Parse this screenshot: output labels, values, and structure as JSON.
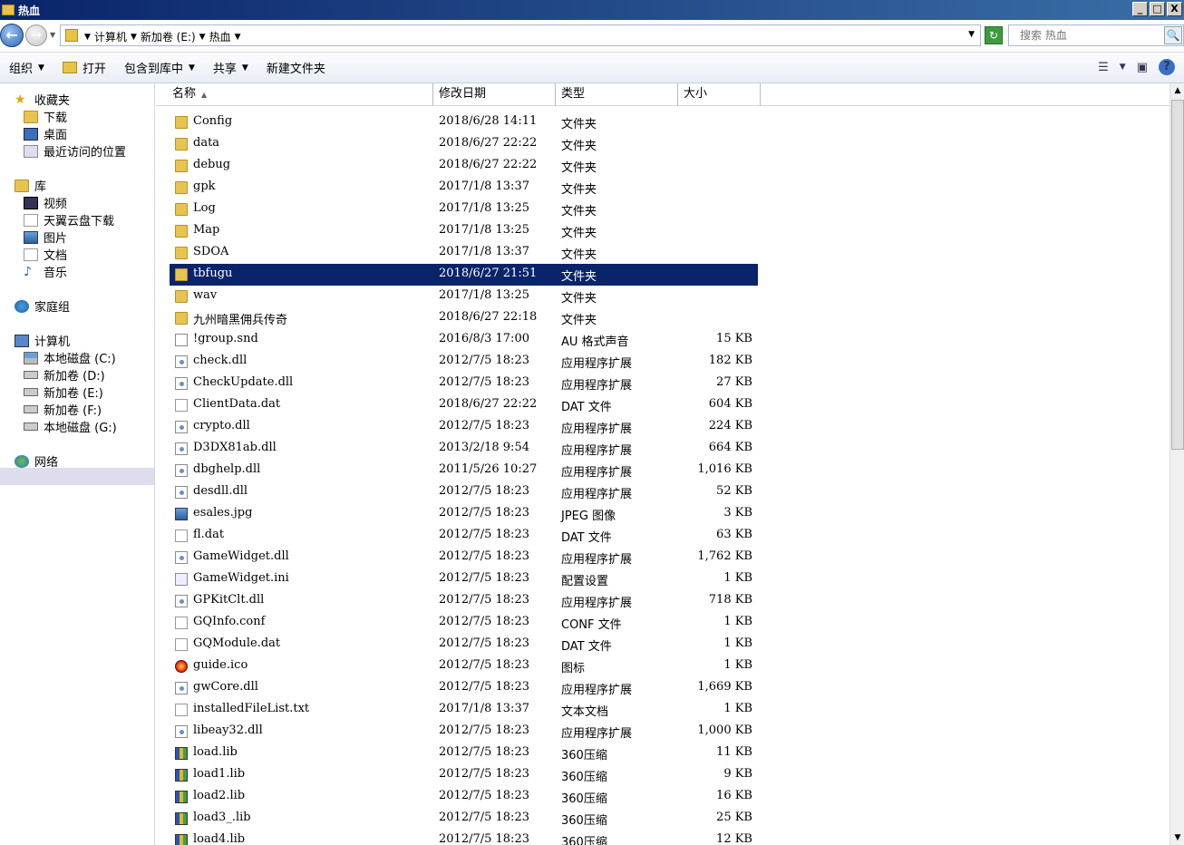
{
  "window": {
    "title": "热血",
    "min": "_",
    "max": "□",
    "close": "X"
  },
  "address": {
    "crumbs": [
      "计算机",
      "新加卷 (E:)",
      "热血"
    ]
  },
  "search": {
    "placeholder": "搜索 热血"
  },
  "toolbar": {
    "organize": "组织",
    "open": "打开",
    "include": "包含到库中",
    "share": "共享",
    "new_folder": "新建文件夹"
  },
  "nav": {
    "favorites": "收藏夹",
    "downloads": "下载",
    "desktop": "桌面",
    "recent": "最近访问的位置",
    "libraries": "库",
    "videos": "视频",
    "tianyi": "天翼云盘下载",
    "pictures": "图片",
    "documents": "文档",
    "music": "音乐",
    "homegroup": "家庭组",
    "computer": "计算机",
    "c": "本地磁盘 (C:)",
    "d": "新加卷 (D:)",
    "e": "新加卷 (E:)",
    "f": "新加卷 (F:)",
    "g": "本地磁盘 (G:)",
    "network": "网络"
  },
  "columns": {
    "name": "名称",
    "date": "修改日期",
    "type": "类型",
    "size": "大小"
  },
  "files": [
    {
      "name": "Config",
      "date": "2018/6/28 14:11",
      "type": "文件夹",
      "size": "",
      "icon": "folder"
    },
    {
      "name": "data",
      "date": "2018/6/27 22:22",
      "type": "文件夹",
      "size": "",
      "icon": "folder"
    },
    {
      "name": "debug",
      "date": "2018/6/27 22:22",
      "type": "文件夹",
      "size": "",
      "icon": "folder"
    },
    {
      "name": "gpk",
      "date": "2017/1/8 13:37",
      "type": "文件夹",
      "size": "",
      "icon": "folder"
    },
    {
      "name": "Log",
      "date": "2017/1/8 13:25",
      "type": "文件夹",
      "size": "",
      "icon": "folder"
    },
    {
      "name": "Map",
      "date": "2017/1/8 13:25",
      "type": "文件夹",
      "size": "",
      "icon": "folder"
    },
    {
      "name": "SDOA",
      "date": "2017/1/8 13:37",
      "type": "文件夹",
      "size": "",
      "icon": "folder"
    },
    {
      "name": "tbfugu",
      "date": "2018/6/27 21:51",
      "type": "文件夹",
      "size": "",
      "icon": "folder",
      "selected": true
    },
    {
      "name": "wav",
      "date": "2017/1/8 13:25",
      "type": "文件夹",
      "size": "",
      "icon": "folder"
    },
    {
      "name": "九州暗黑佣兵传奇",
      "date": "2018/6/27 22:18",
      "type": "文件夹",
      "size": "",
      "icon": "folder"
    },
    {
      "name": "!group.snd",
      "date": "2016/8/3 17:00",
      "type": "AU 格式声音",
      "size": "15 KB",
      "icon": "snd"
    },
    {
      "name": "check.dll",
      "date": "2012/7/5 18:23",
      "type": "应用程序扩展",
      "size": "182 KB",
      "icon": "dll"
    },
    {
      "name": "CheckUpdate.dll",
      "date": "2012/7/5 18:23",
      "type": "应用程序扩展",
      "size": "27 KB",
      "icon": "dll"
    },
    {
      "name": "ClientData.dat",
      "date": "2018/6/27 22:22",
      "type": "DAT 文件",
      "size": "604 KB",
      "icon": "file"
    },
    {
      "name": "crypto.dll",
      "date": "2012/7/5 18:23",
      "type": "应用程序扩展",
      "size": "224 KB",
      "icon": "dll"
    },
    {
      "name": "D3DX81ab.dll",
      "date": "2013/2/18 9:54",
      "type": "应用程序扩展",
      "size": "664 KB",
      "icon": "dll"
    },
    {
      "name": "dbghelp.dll",
      "date": "2011/5/26 10:27",
      "type": "应用程序扩展",
      "size": "1,016 KB",
      "icon": "dll"
    },
    {
      "name": "desdll.dll",
      "date": "2012/7/5 18:23",
      "type": "应用程序扩展",
      "size": "52 KB",
      "icon": "dll"
    },
    {
      "name": "esales.jpg",
      "date": "2012/7/5 18:23",
      "type": "JPEG 图像",
      "size": "3 KB",
      "icon": "jpg"
    },
    {
      "name": "fl.dat",
      "date": "2012/7/5 18:23",
      "type": "DAT 文件",
      "size": "63 KB",
      "icon": "file"
    },
    {
      "name": "GameWidget.dll",
      "date": "2012/7/5 18:23",
      "type": "应用程序扩展",
      "size": "1,762 KB",
      "icon": "dll"
    },
    {
      "name": "GameWidget.ini",
      "date": "2012/7/5 18:23",
      "type": "配置设置",
      "size": "1 KB",
      "icon": "ini"
    },
    {
      "name": "GPKitClt.dll",
      "date": "2012/7/5 18:23",
      "type": "应用程序扩展",
      "size": "718 KB",
      "icon": "dll"
    },
    {
      "name": "GQInfo.conf",
      "date": "2012/7/5 18:23",
      "type": "CONF 文件",
      "size": "1 KB",
      "icon": "file"
    },
    {
      "name": "GQModule.dat",
      "date": "2012/7/5 18:23",
      "type": "DAT 文件",
      "size": "1 KB",
      "icon": "file"
    },
    {
      "name": "guide.ico",
      "date": "2012/7/5 18:23",
      "type": "图标",
      "size": "1 KB",
      "icon": "ico"
    },
    {
      "name": "gwCore.dll",
      "date": "2012/7/5 18:23",
      "type": "应用程序扩展",
      "size": "1,669 KB",
      "icon": "dll"
    },
    {
      "name": "installedFileList.txt",
      "date": "2017/1/8 13:37",
      "type": "文本文档",
      "size": "1 KB",
      "icon": "file"
    },
    {
      "name": "libeay32.dll",
      "date": "2012/7/5 18:23",
      "type": "应用程序扩展",
      "size": "1,000 KB",
      "icon": "dll"
    },
    {
      "name": "load.lib",
      "date": "2012/7/5 18:23",
      "type": "360压缩",
      "size": "11 KB",
      "icon": "zip"
    },
    {
      "name": "load1.lib",
      "date": "2012/7/5 18:23",
      "type": "360压缩",
      "size": "9 KB",
      "icon": "zip"
    },
    {
      "name": "load2.lib",
      "date": "2012/7/5 18:23",
      "type": "360压缩",
      "size": "16 KB",
      "icon": "zip"
    },
    {
      "name": "load3_.lib",
      "date": "2012/7/5 18:23",
      "type": "360压缩",
      "size": "25 KB",
      "icon": "zip"
    },
    {
      "name": "load4.lib",
      "date": "2012/7/5 18:23",
      "type": "360压缩",
      "size": "12 KB",
      "icon": "zip"
    }
  ]
}
